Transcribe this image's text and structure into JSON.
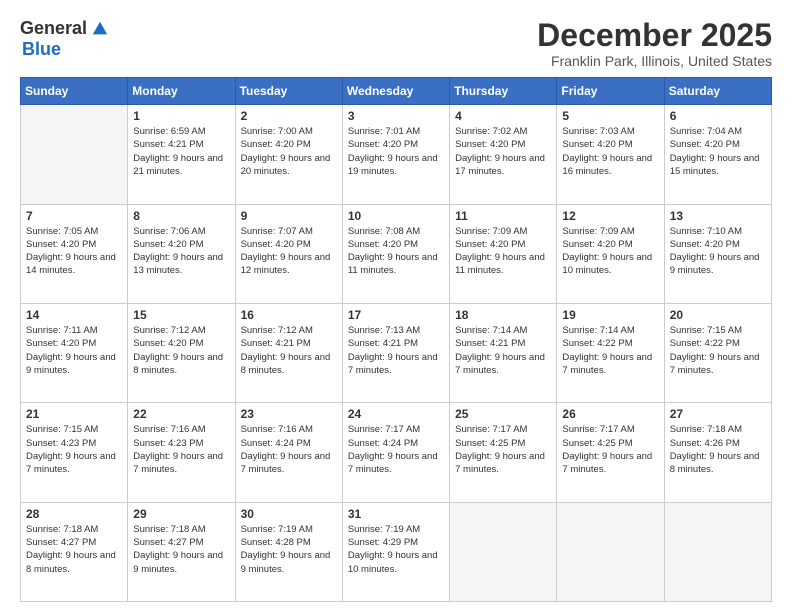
{
  "logo": {
    "general": "General",
    "blue": "Blue"
  },
  "header": {
    "month": "December 2025",
    "location": "Franklin Park, Illinois, United States"
  },
  "weekdays": [
    "Sunday",
    "Monday",
    "Tuesday",
    "Wednesday",
    "Thursday",
    "Friday",
    "Saturday"
  ],
  "weeks": [
    [
      {
        "day": "",
        "sunrise": "",
        "sunset": "",
        "daylight": ""
      },
      {
        "day": "1",
        "sunrise": "Sunrise: 6:59 AM",
        "sunset": "Sunset: 4:21 PM",
        "daylight": "Daylight: 9 hours and 21 minutes."
      },
      {
        "day": "2",
        "sunrise": "Sunrise: 7:00 AM",
        "sunset": "Sunset: 4:20 PM",
        "daylight": "Daylight: 9 hours and 20 minutes."
      },
      {
        "day": "3",
        "sunrise": "Sunrise: 7:01 AM",
        "sunset": "Sunset: 4:20 PM",
        "daylight": "Daylight: 9 hours and 19 minutes."
      },
      {
        "day": "4",
        "sunrise": "Sunrise: 7:02 AM",
        "sunset": "Sunset: 4:20 PM",
        "daylight": "Daylight: 9 hours and 17 minutes."
      },
      {
        "day": "5",
        "sunrise": "Sunrise: 7:03 AM",
        "sunset": "Sunset: 4:20 PM",
        "daylight": "Daylight: 9 hours and 16 minutes."
      },
      {
        "day": "6",
        "sunrise": "Sunrise: 7:04 AM",
        "sunset": "Sunset: 4:20 PM",
        "daylight": "Daylight: 9 hours and 15 minutes."
      }
    ],
    [
      {
        "day": "7",
        "sunrise": "Sunrise: 7:05 AM",
        "sunset": "Sunset: 4:20 PM",
        "daylight": "Daylight: 9 hours and 14 minutes."
      },
      {
        "day": "8",
        "sunrise": "Sunrise: 7:06 AM",
        "sunset": "Sunset: 4:20 PM",
        "daylight": "Daylight: 9 hours and 13 minutes."
      },
      {
        "day": "9",
        "sunrise": "Sunrise: 7:07 AM",
        "sunset": "Sunset: 4:20 PM",
        "daylight": "Daylight: 9 hours and 12 minutes."
      },
      {
        "day": "10",
        "sunrise": "Sunrise: 7:08 AM",
        "sunset": "Sunset: 4:20 PM",
        "daylight": "Daylight: 9 hours and 11 minutes."
      },
      {
        "day": "11",
        "sunrise": "Sunrise: 7:09 AM",
        "sunset": "Sunset: 4:20 PM",
        "daylight": "Daylight: 9 hours and 11 minutes."
      },
      {
        "day": "12",
        "sunrise": "Sunrise: 7:09 AM",
        "sunset": "Sunset: 4:20 PM",
        "daylight": "Daylight: 9 hours and 10 minutes."
      },
      {
        "day": "13",
        "sunrise": "Sunrise: 7:10 AM",
        "sunset": "Sunset: 4:20 PM",
        "daylight": "Daylight: 9 hours and 9 minutes."
      }
    ],
    [
      {
        "day": "14",
        "sunrise": "Sunrise: 7:11 AM",
        "sunset": "Sunset: 4:20 PM",
        "daylight": "Daylight: 9 hours and 9 minutes."
      },
      {
        "day": "15",
        "sunrise": "Sunrise: 7:12 AM",
        "sunset": "Sunset: 4:20 PM",
        "daylight": "Daylight: 9 hours and 8 minutes."
      },
      {
        "day": "16",
        "sunrise": "Sunrise: 7:12 AM",
        "sunset": "Sunset: 4:21 PM",
        "daylight": "Daylight: 9 hours and 8 minutes."
      },
      {
        "day": "17",
        "sunrise": "Sunrise: 7:13 AM",
        "sunset": "Sunset: 4:21 PM",
        "daylight": "Daylight: 9 hours and 7 minutes."
      },
      {
        "day": "18",
        "sunrise": "Sunrise: 7:14 AM",
        "sunset": "Sunset: 4:21 PM",
        "daylight": "Daylight: 9 hours and 7 minutes."
      },
      {
        "day": "19",
        "sunrise": "Sunrise: 7:14 AM",
        "sunset": "Sunset: 4:22 PM",
        "daylight": "Daylight: 9 hours and 7 minutes."
      },
      {
        "day": "20",
        "sunrise": "Sunrise: 7:15 AM",
        "sunset": "Sunset: 4:22 PM",
        "daylight": "Daylight: 9 hours and 7 minutes."
      }
    ],
    [
      {
        "day": "21",
        "sunrise": "Sunrise: 7:15 AM",
        "sunset": "Sunset: 4:23 PM",
        "daylight": "Daylight: 9 hours and 7 minutes."
      },
      {
        "day": "22",
        "sunrise": "Sunrise: 7:16 AM",
        "sunset": "Sunset: 4:23 PM",
        "daylight": "Daylight: 9 hours and 7 minutes."
      },
      {
        "day": "23",
        "sunrise": "Sunrise: 7:16 AM",
        "sunset": "Sunset: 4:24 PM",
        "daylight": "Daylight: 9 hours and 7 minutes."
      },
      {
        "day": "24",
        "sunrise": "Sunrise: 7:17 AM",
        "sunset": "Sunset: 4:24 PM",
        "daylight": "Daylight: 9 hours and 7 minutes."
      },
      {
        "day": "25",
        "sunrise": "Sunrise: 7:17 AM",
        "sunset": "Sunset: 4:25 PM",
        "daylight": "Daylight: 9 hours and 7 minutes."
      },
      {
        "day": "26",
        "sunrise": "Sunrise: 7:17 AM",
        "sunset": "Sunset: 4:25 PM",
        "daylight": "Daylight: 9 hours and 7 minutes."
      },
      {
        "day": "27",
        "sunrise": "Sunrise: 7:18 AM",
        "sunset": "Sunset: 4:26 PM",
        "daylight": "Daylight: 9 hours and 8 minutes."
      }
    ],
    [
      {
        "day": "28",
        "sunrise": "Sunrise: 7:18 AM",
        "sunset": "Sunset: 4:27 PM",
        "daylight": "Daylight: 9 hours and 8 minutes."
      },
      {
        "day": "29",
        "sunrise": "Sunrise: 7:18 AM",
        "sunset": "Sunset: 4:27 PM",
        "daylight": "Daylight: 9 hours and 9 minutes."
      },
      {
        "day": "30",
        "sunrise": "Sunrise: 7:19 AM",
        "sunset": "Sunset: 4:28 PM",
        "daylight": "Daylight: 9 hours and 9 minutes."
      },
      {
        "day": "31",
        "sunrise": "Sunrise: 7:19 AM",
        "sunset": "Sunset: 4:29 PM",
        "daylight": "Daylight: 9 hours and 10 minutes."
      },
      {
        "day": "",
        "sunrise": "",
        "sunset": "",
        "daylight": ""
      },
      {
        "day": "",
        "sunrise": "",
        "sunset": "",
        "daylight": ""
      },
      {
        "day": "",
        "sunrise": "",
        "sunset": "",
        "daylight": ""
      }
    ]
  ]
}
